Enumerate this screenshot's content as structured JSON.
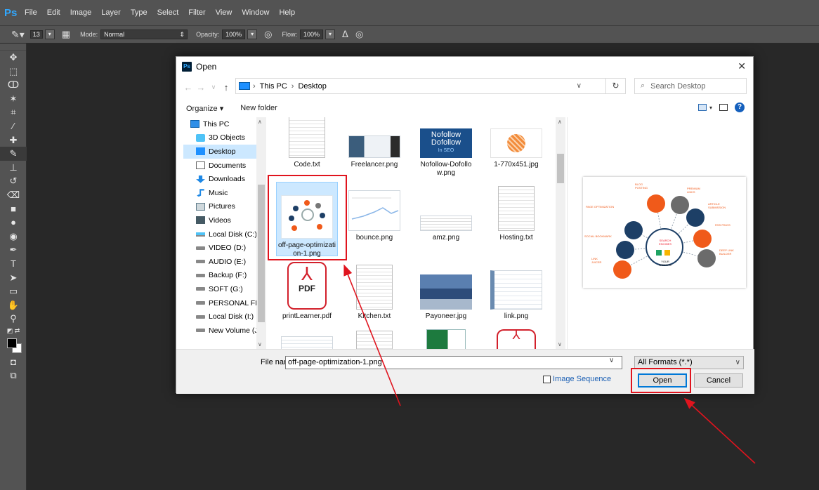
{
  "app": {
    "logo": "Ps",
    "menu": [
      "File",
      "Edit",
      "Image",
      "Layer",
      "Type",
      "Select",
      "Filter",
      "View",
      "Window",
      "Help"
    ]
  },
  "options_bar": {
    "brush_size": "13",
    "mode_label": "Mode:",
    "mode_value": "Normal",
    "opacity_label": "Opacity:",
    "opacity_value": "100%",
    "flow_label": "Flow:",
    "flow_value": "100%"
  },
  "dialog": {
    "title": "Open",
    "close": "✕",
    "breadcrumb": [
      "This PC",
      "Desktop"
    ],
    "search_placeholder": "Search Desktop",
    "organize": "Organize ▾",
    "new_folder": "New folder",
    "nav_items": [
      {
        "label": "This PC",
        "icon": "computer-icon"
      },
      {
        "label": "3D Objects",
        "icon": "3d-objects-icon"
      },
      {
        "label": "Desktop",
        "icon": "desktop-icon"
      },
      {
        "label": "Documents",
        "icon": "documents-icon"
      },
      {
        "label": "Downloads",
        "icon": "downloads-icon"
      },
      {
        "label": "Music",
        "icon": "music-icon"
      },
      {
        "label": "Pictures",
        "icon": "pictures-icon"
      },
      {
        "label": "Videos",
        "icon": "videos-icon"
      },
      {
        "label": "Local Disk (C:)",
        "icon": "disk-icon"
      },
      {
        "label": "VIDEO (D:)",
        "icon": "drive-icon"
      },
      {
        "label": "AUDIO (E:)",
        "icon": "drive-icon"
      },
      {
        "label": "Backup (F:)",
        "icon": "drive-icon"
      },
      {
        "label": "SOFT (G:)",
        "icon": "drive-icon"
      },
      {
        "label": "PERSONAL FILES",
        "icon": "drive-icon"
      },
      {
        "label": "Local Disk (I:)",
        "icon": "drive-icon"
      },
      {
        "label": "New Volume (J:)",
        "icon": "drive-icon"
      }
    ],
    "files": [
      {
        "name": "Code.txt",
        "kind": "txt"
      },
      {
        "name": "Freelancer.png",
        "kind": "img"
      },
      {
        "name": "Nofollow-Dofollow.png",
        "kind": "img"
      },
      {
        "name": "1-770x451.jpg",
        "kind": "img"
      },
      {
        "name": "off-page-optimization-1.png",
        "kind": "img"
      },
      {
        "name": "bounce.png",
        "kind": "img"
      },
      {
        "name": "amz.png",
        "kind": "img"
      },
      {
        "name": "Hosting.txt",
        "kind": "txt"
      },
      {
        "name": "printLearner.pdf",
        "kind": "pdf"
      },
      {
        "name": "Kitchen.txt",
        "kind": "txt"
      },
      {
        "name": "Payoneer.jpg",
        "kind": "img"
      },
      {
        "name": "link.png",
        "kind": "img"
      }
    ],
    "thumb_text": {
      "nofollow": "Nofollow",
      "dofollow": "Dofollow",
      "in_seo": "In SEO",
      "pdf": "PDF"
    },
    "file_name_label": "File name:",
    "file_name_value": "off-page-optimization-1.png",
    "format_value": "All Formats (*.*)",
    "image_sequence": "Image Sequence",
    "open_button": "Open",
    "cancel_button": "Cancel"
  },
  "preview_labels": {
    "blog": "BLOG POSTING",
    "premium": "PREMIUM LINKS",
    "article": "ARTICLE SUBMISSION",
    "page": "PAGE OPTIMIZATION",
    "rss": "RSS PINGS",
    "social": "SOCIAL BOOKMARK",
    "deeplink": "DEEP LINK BUILDER",
    "link": "LINK JUICER",
    "search": "SEARCH ENGINES",
    "website": "YOUR WEBSITE"
  },
  "colors": {
    "accent_red": "#e0141e",
    "selection_blue": "#cce8ff",
    "ps_blue": "#31a8ff"
  }
}
